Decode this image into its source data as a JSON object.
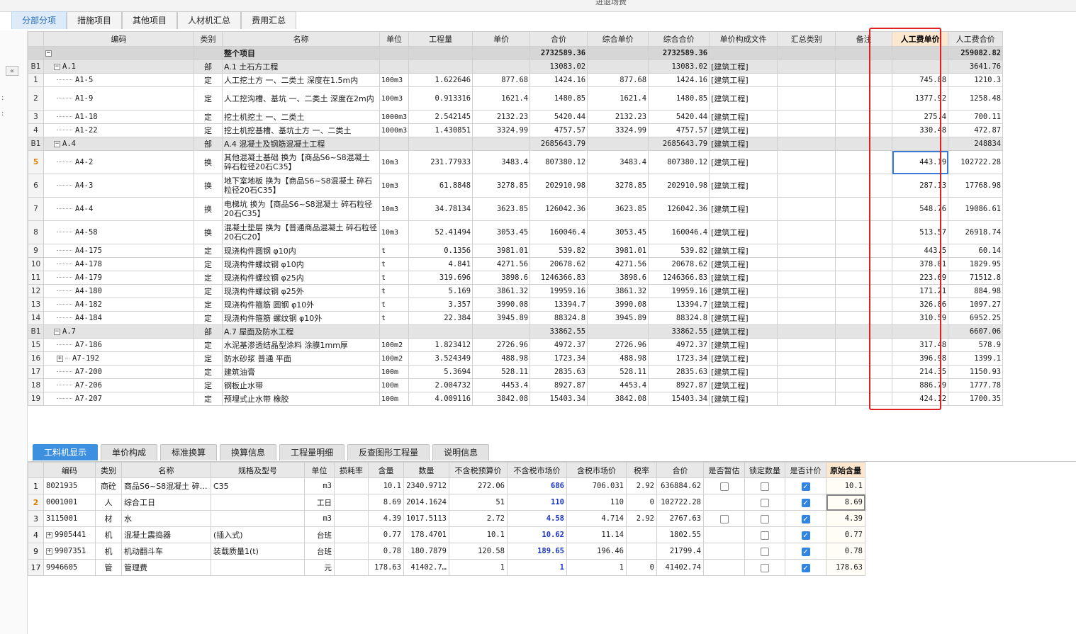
{
  "window_title": "进退场费",
  "top_tabs": [
    "分部分项",
    "措施项目",
    "其他项目",
    "人材机汇总",
    "费用汇总"
  ],
  "grid_headers": [
    "",
    "编码",
    "类别",
    "名称",
    "单位",
    "工程量",
    "单价",
    "合价",
    "综合单价",
    "综合合价",
    "单价构成文件",
    "汇总类别",
    "备注",
    "人工费单价",
    "人工费合价"
  ],
  "rows": [
    {
      "rn": "",
      "code": "",
      "type": "",
      "name": "整个项目",
      "unit": "",
      "qty": "",
      "price": "",
      "total": "2732589.36",
      "cprice": "",
      "ctotal": "2732589.36",
      "file": "",
      "sum": "",
      "note": "",
      "lprice": "",
      "ltotal": "259082.82",
      "kind": "root"
    },
    {
      "rn": "B1",
      "code": "A.1",
      "type": "部",
      "name": "A.1 土石方工程",
      "unit": "",
      "qty": "",
      "price": "",
      "total": "13083.02",
      "cprice": "",
      "ctotal": "13083.02",
      "file": "[建筑工程]",
      "sum": "",
      "note": "",
      "lprice": "",
      "ltotal": "3641.76",
      "kind": "sec"
    },
    {
      "rn": "1",
      "code": "A1-5",
      "type": "定",
      "name": "人工挖土方 一、二类土 深度在1.5m内",
      "unit": "100m3",
      "qty": "1.622646",
      "price": "877.68",
      "total": "1424.16",
      "cprice": "877.68",
      "ctotal": "1424.16",
      "file": "[建筑工程]",
      "sum": "",
      "note": "",
      "lprice": "745.88",
      "ltotal": "1210.3",
      "kind": ""
    },
    {
      "rn": "2",
      "code": "A1-9",
      "type": "定",
      "name": "人工挖沟槽、基坑 一、二类土 深度在2m内",
      "unit": "100m3",
      "qty": "0.913316",
      "price": "1621.4",
      "total": "1480.85",
      "cprice": "1621.4",
      "ctotal": "1480.85",
      "file": "[建筑工程]",
      "sum": "",
      "note": "",
      "lprice": "1377.92",
      "ltotal": "1258.48",
      "kind": "r2"
    },
    {
      "rn": "3",
      "code": "A1-18",
      "type": "定",
      "name": "挖土机挖土 一、二类土",
      "unit": "1000m3",
      "qty": "2.542145",
      "price": "2132.23",
      "total": "5420.44",
      "cprice": "2132.23",
      "ctotal": "5420.44",
      "file": "[建筑工程]",
      "sum": "",
      "note": "",
      "lprice": "275.4",
      "ltotal": "700.11",
      "kind": ""
    },
    {
      "rn": "4",
      "code": "A1-22",
      "type": "定",
      "name": "挖土机挖基槽、基坑土方 一、二类土",
      "unit": "1000m3",
      "qty": "1.430851",
      "price": "3324.99",
      "total": "4757.57",
      "cprice": "3324.99",
      "ctotal": "4757.57",
      "file": "[建筑工程]",
      "sum": "",
      "note": "",
      "lprice": "330.48",
      "ltotal": "472.87",
      "kind": ""
    },
    {
      "rn": "B1",
      "code": "A.4",
      "type": "部",
      "name": "A.4 混凝土及钢筋混凝土工程",
      "unit": "",
      "qty": "",
      "price": "",
      "total": "2685643.79",
      "cprice": "",
      "ctotal": "2685643.79",
      "file": "[建筑工程]",
      "sum": "",
      "note": "",
      "lprice": "",
      "ltotal": "248834",
      "kind": "sec"
    },
    {
      "rn": "5",
      "code": "A4-2",
      "type": "换",
      "name": "其他混凝土基础 换为【商品S6~S8混凝土 碎石粒径20石C35】",
      "unit": "10m3",
      "qty": "231.77933",
      "price": "3483.4",
      "total": "807380.12",
      "cprice": "3483.4",
      "ctotal": "807380.12",
      "file": "[建筑工程]",
      "sum": "",
      "note": "",
      "lprice": "443.19",
      "ltotal": "102722.28",
      "kind": "r2 sel"
    },
    {
      "rn": "6",
      "code": "A4-3",
      "type": "换",
      "name": "地下室地板 换为【商品S6~S8混凝土 碎石粒径20石C35】",
      "unit": "10m3",
      "qty": "61.8848",
      "price": "3278.85",
      "total": "202910.98",
      "cprice": "3278.85",
      "ctotal": "202910.98",
      "file": "[建筑工程]",
      "sum": "",
      "note": "",
      "lprice": "287.13",
      "ltotal": "17768.98",
      "kind": "r2"
    },
    {
      "rn": "7",
      "code": "A4-4",
      "type": "换",
      "name": "电梯坑 换为【商品S6~S8混凝土 碎石粒径20石C35】",
      "unit": "10m3",
      "qty": "34.78134",
      "price": "3623.85",
      "total": "126042.36",
      "cprice": "3623.85",
      "ctotal": "126042.36",
      "file": "[建筑工程]",
      "sum": "",
      "note": "",
      "lprice": "548.76",
      "ltotal": "19086.61",
      "kind": "r2"
    },
    {
      "rn": "8",
      "code": "A4-58",
      "type": "换",
      "name": "混凝土垫层 换为【普通商品混凝土 碎石粒径20石C20】",
      "unit": "10m3",
      "qty": "52.41494",
      "price": "3053.45",
      "total": "160046.4",
      "cprice": "3053.45",
      "ctotal": "160046.4",
      "file": "[建筑工程]",
      "sum": "",
      "note": "",
      "lprice": "513.57",
      "ltotal": "26918.74",
      "kind": "r2"
    },
    {
      "rn": "9",
      "code": "A4-175",
      "type": "定",
      "name": "现浇构件圆钢 φ10内",
      "unit": "t",
      "qty": "0.1356",
      "price": "3981.01",
      "total": "539.82",
      "cprice": "3981.01",
      "ctotal": "539.82",
      "file": "[建筑工程]",
      "sum": "",
      "note": "",
      "lprice": "443.5",
      "ltotal": "60.14",
      "kind": ""
    },
    {
      "rn": "10",
      "code": "A4-178",
      "type": "定",
      "name": "现浇构件螺纹钢 φ10内",
      "unit": "t",
      "qty": "4.841",
      "price": "4271.56",
      "total": "20678.62",
      "cprice": "4271.56",
      "ctotal": "20678.62",
      "file": "[建筑工程]",
      "sum": "",
      "note": "",
      "lprice": "378.01",
      "ltotal": "1829.95",
      "kind": ""
    },
    {
      "rn": "11",
      "code": "A4-179",
      "type": "定",
      "name": "现浇构件螺纹钢 φ25内",
      "unit": "t",
      "qty": "319.696",
      "price": "3898.6",
      "total": "1246366.83",
      "cprice": "3898.6",
      "ctotal": "1246366.83",
      "file": "[建筑工程]",
      "sum": "",
      "note": "",
      "lprice": "223.69",
      "ltotal": "71512.8",
      "kind": ""
    },
    {
      "rn": "12",
      "code": "A4-180",
      "type": "定",
      "name": "现浇构件螺纹钢 φ25外",
      "unit": "t",
      "qty": "5.169",
      "price": "3861.32",
      "total": "19959.16",
      "cprice": "3861.32",
      "ctotal": "19959.16",
      "file": "[建筑工程]",
      "sum": "",
      "note": "",
      "lprice": "171.21",
      "ltotal": "884.98",
      "kind": ""
    },
    {
      "rn": "13",
      "code": "A4-182",
      "type": "定",
      "name": "现浇构件箍筋 圆钢 φ10外",
      "unit": "t",
      "qty": "3.357",
      "price": "3990.08",
      "total": "13394.7",
      "cprice": "3990.08",
      "ctotal": "13394.7",
      "file": "[建筑工程]",
      "sum": "",
      "note": "",
      "lprice": "326.86",
      "ltotal": "1097.27",
      "kind": ""
    },
    {
      "rn": "14",
      "code": "A4-184",
      "type": "定",
      "name": "现浇构件箍筋 螺纹钢 φ10外",
      "unit": "t",
      "qty": "22.384",
      "price": "3945.89",
      "total": "88324.8",
      "cprice": "3945.89",
      "ctotal": "88324.8",
      "file": "[建筑工程]",
      "sum": "",
      "note": "",
      "lprice": "310.59",
      "ltotal": "6952.25",
      "kind": ""
    },
    {
      "rn": "B1",
      "code": "A.7",
      "type": "部",
      "name": "A.7 屋面及防水工程",
      "unit": "",
      "qty": "",
      "price": "",
      "total": "33862.55",
      "cprice": "",
      "ctotal": "33862.55",
      "file": "[建筑工程]",
      "sum": "",
      "note": "",
      "lprice": "",
      "ltotal": "6607.06",
      "kind": "sec"
    },
    {
      "rn": "15",
      "code": "A7-186",
      "type": "定",
      "name": "水泥基渗透结晶型涂料 涂膜1mm厚",
      "unit": "100m2",
      "qty": "1.823412",
      "price": "2726.96",
      "total": "4972.37",
      "cprice": "2726.96",
      "ctotal": "4972.37",
      "file": "[建筑工程]",
      "sum": "",
      "note": "",
      "lprice": "317.48",
      "ltotal": "578.9",
      "kind": ""
    },
    {
      "rn": "16",
      "code": "A7-192",
      "type": "定",
      "name": "防水砂浆 普通 平面",
      "unit": "100m2",
      "qty": "3.524349",
      "price": "488.98",
      "total": "1723.34",
      "cprice": "488.98",
      "ctotal": "1723.34",
      "file": "[建筑工程]",
      "sum": "",
      "note": "",
      "lprice": "396.98",
      "ltotal": "1399.1",
      "kind": "plus"
    },
    {
      "rn": "17",
      "code": "A7-200",
      "type": "定",
      "name": "建筑油膏",
      "unit": "100m",
      "qty": "5.3694",
      "price": "528.11",
      "total": "2835.63",
      "cprice": "528.11",
      "ctotal": "2835.63",
      "file": "[建筑工程]",
      "sum": "",
      "note": "",
      "lprice": "214.35",
      "ltotal": "1150.93",
      "kind": ""
    },
    {
      "rn": "18",
      "code": "A7-206",
      "type": "定",
      "name": "钢板止水带",
      "unit": "100m",
      "qty": "2.004732",
      "price": "4453.4",
      "total": "8927.87",
      "cprice": "4453.4",
      "ctotal": "8927.87",
      "file": "[建筑工程]",
      "sum": "",
      "note": "",
      "lprice": "886.79",
      "ltotal": "1777.78",
      "kind": ""
    },
    {
      "rn": "19",
      "code": "A7-207",
      "type": "定",
      "name": "预埋式止水带 橡胶",
      "unit": "100m",
      "qty": "4.009116",
      "price": "3842.08",
      "total": "15403.34",
      "cprice": "3842.08",
      "ctotal": "15403.34",
      "file": "[建筑工程]",
      "sum": "",
      "note": "",
      "lprice": "424.12",
      "ltotal": "1700.35",
      "kind": ""
    }
  ],
  "bottom_tabs": [
    "工料机显示",
    "单价构成",
    "标准换算",
    "换算信息",
    "工程量明细",
    "反查图形工程量",
    "说明信息"
  ],
  "grid2_headers": [
    "",
    "编码",
    "类别",
    "名称",
    "规格及型号",
    "单位",
    "损耗率",
    "含量",
    "数量",
    "不含税预算价",
    "不含税市场价",
    "含税市场价",
    "税率",
    "合价",
    "是否暂估",
    "锁定数量",
    "是否计价",
    "原始含量"
  ],
  "rows2": [
    {
      "rn": "1",
      "code": "8021935",
      "type": "商砼",
      "name": "商品S6~S8混凝土 碎…",
      "spec": "C35",
      "unit": "m3",
      "loss": "",
      "content": "10.1",
      "qty": "2340.9712",
      "bprice": "272.06",
      "mprice": "686",
      "tprice": "706.031",
      "tax": "2.92",
      "total": "636884.62",
      "est": "off",
      "lock": "off",
      "priced": "on",
      "orig": "10.1",
      "plus": false
    },
    {
      "rn": "2",
      "code": "0001001",
      "type": "人",
      "name": "综合工日",
      "spec": "",
      "unit": "工日",
      "loss": "",
      "content": "8.69",
      "qty": "2014.1624",
      "bprice": "51",
      "mprice": "110",
      "tprice": "110",
      "tax": "0",
      "total": "102722.28",
      "est": "",
      "lock": "off",
      "priced": "on",
      "orig": "8.69",
      "plus": false
    },
    {
      "rn": "3",
      "code": "3115001",
      "type": "材",
      "name": "水",
      "spec": "",
      "unit": "m3",
      "loss": "",
      "content": "4.39",
      "qty": "1017.5113",
      "bprice": "2.72",
      "mprice": "4.58",
      "tprice": "4.714",
      "tax": "2.92",
      "total": "2767.63",
      "est": "off",
      "lock": "off",
      "priced": "on",
      "orig": "4.39",
      "plus": false
    },
    {
      "rn": "4",
      "code": "9905441",
      "type": "机",
      "name": "混凝土震捣器",
      "spec": "(插入式)",
      "unit": "台班",
      "loss": "",
      "content": "0.77",
      "qty": "178.4701",
      "bprice": "10.1",
      "mprice": "10.62",
      "tprice": "11.14",
      "tax": "",
      "total": "1802.55",
      "est": "",
      "lock": "off",
      "priced": "on",
      "orig": "0.77",
      "plus": true
    },
    {
      "rn": "9",
      "code": "9907351",
      "type": "机",
      "name": "机动翻斗车",
      "spec": "装载质量1(t)",
      "unit": "台班",
      "loss": "",
      "content": "0.78",
      "qty": "180.7879",
      "bprice": "120.58",
      "mprice": "189.65",
      "tprice": "196.46",
      "tax": "",
      "total": "21799.4",
      "est": "",
      "lock": "off",
      "priced": "on",
      "orig": "0.78",
      "plus": true
    },
    {
      "rn": "17",
      "code": "9946605",
      "type": "管",
      "name": "管理费",
      "spec": "",
      "unit": "元",
      "loss": "",
      "content": "178.63",
      "qty": "41402.7…",
      "bprice": "1",
      "mprice": "1",
      "tprice": "1",
      "tax": "0",
      "total": "41402.74",
      "est": "",
      "lock": "off",
      "priced": "on",
      "orig": "178.63",
      "plus": false
    }
  ],
  "icons": {
    "collapse": "double-chevron-left-icon",
    "check": "✓"
  },
  "colors": {
    "active_tab": "#3d8fe0",
    "highlight": "#e02020",
    "blue_value": "#1a35c8"
  }
}
